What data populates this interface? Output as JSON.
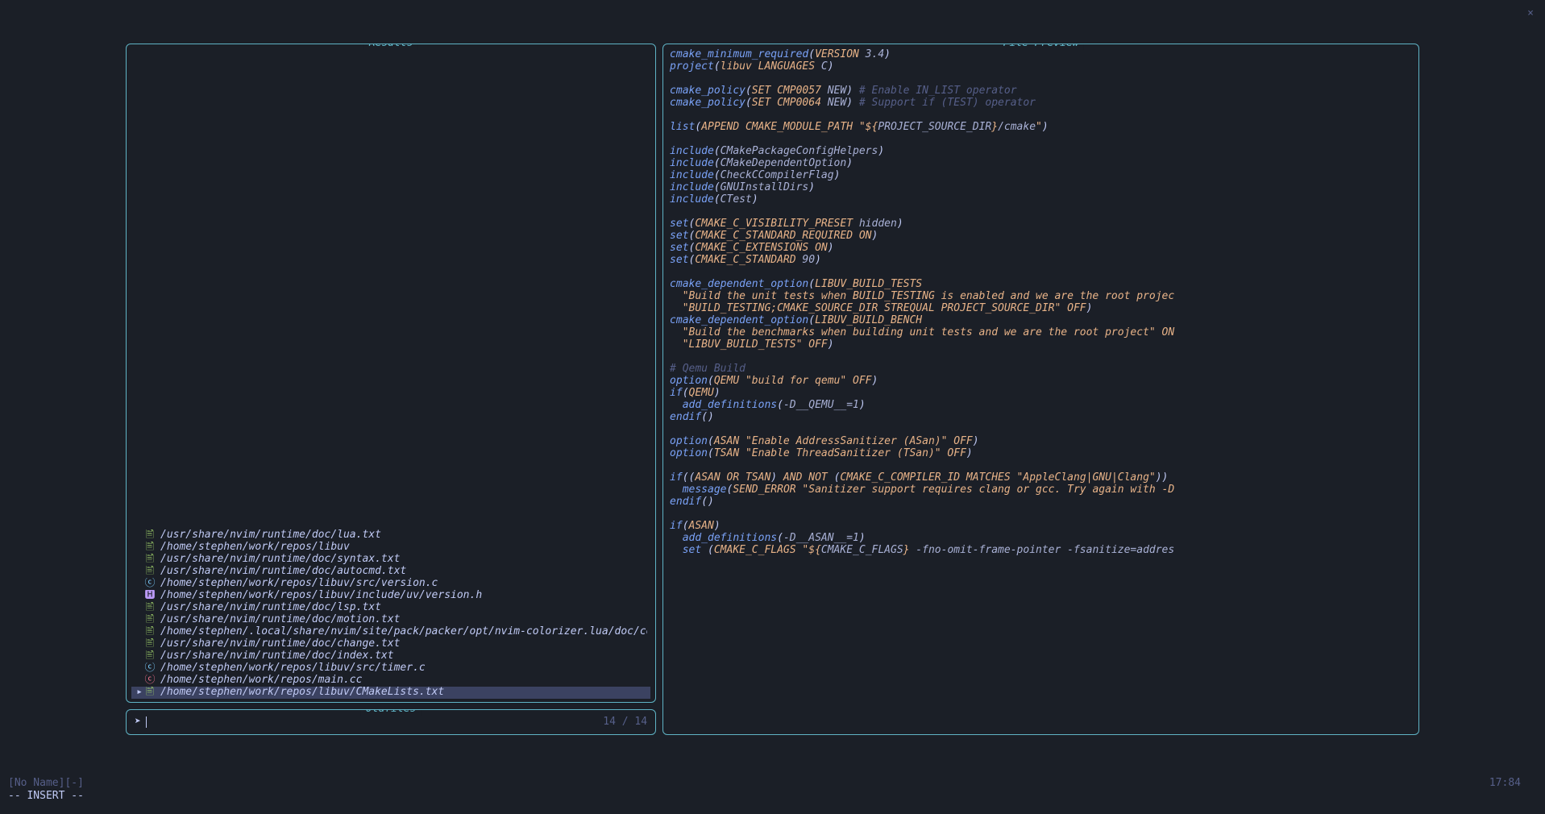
{
  "close_icon": "×",
  "panels": {
    "results_title": "Results",
    "prompt_title": "Oldfiles",
    "preview_title": "File Preview"
  },
  "results": [
    {
      "icon": "🖹",
      "iconClass": "ic-green",
      "path": "/usr/share/nvim/runtime/doc/lua.txt",
      "selected": false
    },
    {
      "icon": "🖹",
      "iconClass": "ic-green",
      "path": "/home/stephen/work/repos/libuv",
      "selected": false
    },
    {
      "icon": "🖹",
      "iconClass": "ic-green",
      "path": "/usr/share/nvim/runtime/doc/syntax.txt",
      "selected": false
    },
    {
      "icon": "🖹",
      "iconClass": "ic-green",
      "path": "/usr/share/nvim/runtime/doc/autocmd.txt",
      "selected": false
    },
    {
      "icon": "ⓒ",
      "iconClass": "ic-cyan",
      "path": "/home/stephen/work/repos/libuv/src/version.c",
      "selected": false
    },
    {
      "icon": "🅷",
      "iconClass": "ic-purple",
      "path": "/home/stephen/work/repos/libuv/include/uv/version.h",
      "selected": false
    },
    {
      "icon": "🖹",
      "iconClass": "ic-green",
      "path": "/usr/share/nvim/runtime/doc/lsp.txt",
      "selected": false
    },
    {
      "icon": "🖹",
      "iconClass": "ic-green",
      "path": "/usr/share/nvim/runtime/doc/motion.txt",
      "selected": false
    },
    {
      "icon": "🖹",
      "iconClass": "ic-green",
      "path": "/home/stephen/.local/share/nvim/site/pack/packer/opt/nvim-colorizer.lua/doc/colo",
      "selected": false
    },
    {
      "icon": "🖹",
      "iconClass": "ic-green",
      "path": "/usr/share/nvim/runtime/doc/change.txt",
      "selected": false
    },
    {
      "icon": "🖹",
      "iconClass": "ic-green",
      "path": "/usr/share/nvim/runtime/doc/index.txt",
      "selected": false
    },
    {
      "icon": "ⓒ",
      "iconClass": "ic-cyan",
      "path": "/home/stephen/work/repos/libuv/src/timer.c",
      "selected": false
    },
    {
      "icon": "ⓒ",
      "iconClass": "ic-red",
      "path": "/home/stephen/work/repos/main.cc",
      "selected": false
    },
    {
      "icon": "🖹",
      "iconClass": "ic-green",
      "path": "/home/stephen/work/repos/libuv/CMakeLists.txt",
      "selected": true
    }
  ],
  "prompt": {
    "icon": "➤",
    "counter": "14 / 14"
  },
  "preview_lines": [
    [
      {
        "c": "kw",
        "t": "cmake_minimum_required"
      },
      {
        "c": "pn",
        "t": "("
      },
      {
        "c": "fn",
        "t": "VERSION"
      },
      {
        "c": "wh",
        "t": " 3.4"
      },
      {
        "c": "pn",
        "t": ")"
      }
    ],
    [
      {
        "c": "kw",
        "t": "project"
      },
      {
        "c": "pn",
        "t": "("
      },
      {
        "c": "fn",
        "t": "libuv LANGUAGES"
      },
      {
        "c": "wh",
        "t": " C"
      },
      {
        "c": "pn",
        "t": ")"
      }
    ],
    [],
    [
      {
        "c": "kw",
        "t": "cmake_policy"
      },
      {
        "c": "pn",
        "t": "("
      },
      {
        "c": "fn",
        "t": "SET CMP0057"
      },
      {
        "c": "wh",
        "t": " NEW"
      },
      {
        "c": "pn",
        "t": ")"
      },
      {
        "c": "cm",
        "t": " # Enable IN_LIST operator"
      }
    ],
    [
      {
        "c": "kw",
        "t": "cmake_policy"
      },
      {
        "c": "pn",
        "t": "("
      },
      {
        "c": "fn",
        "t": "SET CMP0064"
      },
      {
        "c": "wh",
        "t": " NEW"
      },
      {
        "c": "pn",
        "t": ")"
      },
      {
        "c": "cm",
        "t": " # Support if (TEST) operator"
      }
    ],
    [],
    [
      {
        "c": "kw",
        "t": "list"
      },
      {
        "c": "pn",
        "t": "("
      },
      {
        "c": "fn",
        "t": "APPEND CMAKE_MODULE_PATH "
      },
      {
        "c": "str",
        "t": "\"${"
      },
      {
        "c": "wh",
        "t": "PROJECT_SOURCE_DIR"
      },
      {
        "c": "str",
        "t": "}"
      },
      {
        "c": "wh",
        "t": "/cmake"
      },
      {
        "c": "str",
        "t": "\""
      },
      {
        "c": "pn",
        "t": ")"
      }
    ],
    [],
    [
      {
        "c": "kw",
        "t": "include"
      },
      {
        "c": "pn",
        "t": "("
      },
      {
        "c": "wh",
        "t": "CMakePackageConfigHelpers"
      },
      {
        "c": "pn",
        "t": ")"
      }
    ],
    [
      {
        "c": "kw",
        "t": "include"
      },
      {
        "c": "pn",
        "t": "("
      },
      {
        "c": "wh",
        "t": "CMakeDependentOption"
      },
      {
        "c": "pn",
        "t": ")"
      }
    ],
    [
      {
        "c": "kw",
        "t": "include"
      },
      {
        "c": "pn",
        "t": "("
      },
      {
        "c": "wh",
        "t": "CheckCCompilerFlag"
      },
      {
        "c": "pn",
        "t": ")"
      }
    ],
    [
      {
        "c": "kw",
        "t": "include"
      },
      {
        "c": "pn",
        "t": "("
      },
      {
        "c": "wh",
        "t": "GNUInstallDirs"
      },
      {
        "c": "pn",
        "t": ")"
      }
    ],
    [
      {
        "c": "kw",
        "t": "include"
      },
      {
        "c": "pn",
        "t": "("
      },
      {
        "c": "wh",
        "t": "CTest"
      },
      {
        "c": "pn",
        "t": ")"
      }
    ],
    [],
    [
      {
        "c": "kw",
        "t": "set"
      },
      {
        "c": "pn",
        "t": "("
      },
      {
        "c": "fn",
        "t": "CMAKE_C_VISIBILITY_PRESET"
      },
      {
        "c": "wh",
        "t": " hidden"
      },
      {
        "c": "pn",
        "t": ")"
      }
    ],
    [
      {
        "c": "kw",
        "t": "set"
      },
      {
        "c": "pn",
        "t": "("
      },
      {
        "c": "fn",
        "t": "CMAKE_C_STANDARD_REQUIRED ON"
      },
      {
        "c": "pn",
        "t": ")"
      }
    ],
    [
      {
        "c": "kw",
        "t": "set"
      },
      {
        "c": "pn",
        "t": "("
      },
      {
        "c": "fn",
        "t": "CMAKE_C_EXTENSIONS ON"
      },
      {
        "c": "pn",
        "t": ")"
      }
    ],
    [
      {
        "c": "kw",
        "t": "set"
      },
      {
        "c": "pn",
        "t": "("
      },
      {
        "c": "fn",
        "t": "CMAKE_C_STANDARD"
      },
      {
        "c": "wh",
        "t": " 90"
      },
      {
        "c": "pn",
        "t": ")"
      }
    ],
    [],
    [
      {
        "c": "kw",
        "t": "cmake_dependent_option"
      },
      {
        "c": "pn",
        "t": "("
      },
      {
        "c": "fn",
        "t": "LIBUV_BUILD_TESTS"
      }
    ],
    [
      {
        "c": "fn",
        "t": "  \"Build the unit tests when BUILD_TESTING is enabled and we are the root projec"
      }
    ],
    [
      {
        "c": "fn",
        "t": "  \"BUILD_TESTING;CMAKE_SOURCE_DIR STREQUAL PROJECT_SOURCE_DIR\" OFF"
      },
      {
        "c": "pn",
        "t": ")"
      }
    ],
    [
      {
        "c": "kw",
        "t": "cmake_dependent_option"
      },
      {
        "c": "pn",
        "t": "("
      },
      {
        "c": "fn",
        "t": "LIBUV_BUILD_BENCH"
      }
    ],
    [
      {
        "c": "fn",
        "t": "  \"Build the benchmarks when building unit tests and we are the root project\" ON"
      }
    ],
    [
      {
        "c": "fn",
        "t": "  \"LIBUV_BUILD_TESTS\" OFF"
      },
      {
        "c": "pn",
        "t": ")"
      }
    ],
    [],
    [
      {
        "c": "cm",
        "t": "# Qemu Build"
      }
    ],
    [
      {
        "c": "kw",
        "t": "option"
      },
      {
        "c": "pn",
        "t": "("
      },
      {
        "c": "fn",
        "t": "QEMU \"build for qemu\" OFF"
      },
      {
        "c": "pn",
        "t": ")"
      }
    ],
    [
      {
        "c": "kw",
        "t": "if"
      },
      {
        "c": "pn",
        "t": "("
      },
      {
        "c": "fn",
        "t": "QEMU"
      },
      {
        "c": "pn",
        "t": ")"
      }
    ],
    [
      {
        "c": "kw",
        "t": "  add_definitions"
      },
      {
        "c": "pn",
        "t": "("
      },
      {
        "c": "wh",
        "t": "-D__QEMU__=1"
      },
      {
        "c": "pn",
        "t": ")"
      }
    ],
    [
      {
        "c": "kw",
        "t": "endif"
      },
      {
        "c": "pn",
        "t": "()"
      }
    ],
    [],
    [
      {
        "c": "kw",
        "t": "option"
      },
      {
        "c": "pn",
        "t": "("
      },
      {
        "c": "fn",
        "t": "ASAN \"Enable AddressSanitizer (ASan)\" OFF"
      },
      {
        "c": "pn",
        "t": ")"
      }
    ],
    [
      {
        "c": "kw",
        "t": "option"
      },
      {
        "c": "pn",
        "t": "("
      },
      {
        "c": "fn",
        "t": "TSAN \"Enable ThreadSanitizer (TSan)\" OFF"
      },
      {
        "c": "pn",
        "t": ")"
      }
    ],
    [],
    [
      {
        "c": "kw",
        "t": "if"
      },
      {
        "c": "pn",
        "t": "(("
      },
      {
        "c": "fn",
        "t": "ASAN OR TSAN"
      },
      {
        "c": "pn",
        "t": ")"
      },
      {
        "c": "fn",
        "t": " AND NOT "
      },
      {
        "c": "pn",
        "t": "("
      },
      {
        "c": "fn",
        "t": "CMAKE_C_COMPILER_ID MATCHES "
      },
      {
        "c": "str",
        "t": "\"AppleClang|GNU|Clang\""
      },
      {
        "c": "pn",
        "t": "))"
      }
    ],
    [
      {
        "c": "kw",
        "t": "  message"
      },
      {
        "c": "pn",
        "t": "("
      },
      {
        "c": "fn",
        "t": "SEND_ERROR "
      },
      {
        "c": "str",
        "t": "\"Sanitizer support requires clang or gcc. Try again with -D"
      }
    ],
    [
      {
        "c": "kw",
        "t": "endif"
      },
      {
        "c": "pn",
        "t": "()"
      }
    ],
    [],
    [
      {
        "c": "kw",
        "t": "if"
      },
      {
        "c": "pn",
        "t": "("
      },
      {
        "c": "fn",
        "t": "ASAN"
      },
      {
        "c": "pn",
        "t": ")"
      }
    ],
    [
      {
        "c": "kw",
        "t": "  add_definitions"
      },
      {
        "c": "pn",
        "t": "("
      },
      {
        "c": "wh",
        "t": "-D__ASAN__=1"
      },
      {
        "c": "pn",
        "t": ")"
      }
    ],
    [
      {
        "c": "kw",
        "t": "  set "
      },
      {
        "c": "pn",
        "t": "("
      },
      {
        "c": "fn",
        "t": "CMAKE_C_FLAGS "
      },
      {
        "c": "str",
        "t": "\"${"
      },
      {
        "c": "wh",
        "t": "CMAKE_C_FLAGS"
      },
      {
        "c": "str",
        "t": "}"
      },
      {
        "c": "wh",
        "t": " -fno-omit-frame-pointer -fsanitize=addres"
      }
    ]
  ],
  "status": {
    "buffer": "[No Name][-]",
    "mode": "-- INSERT --",
    "pos": "17:84"
  }
}
